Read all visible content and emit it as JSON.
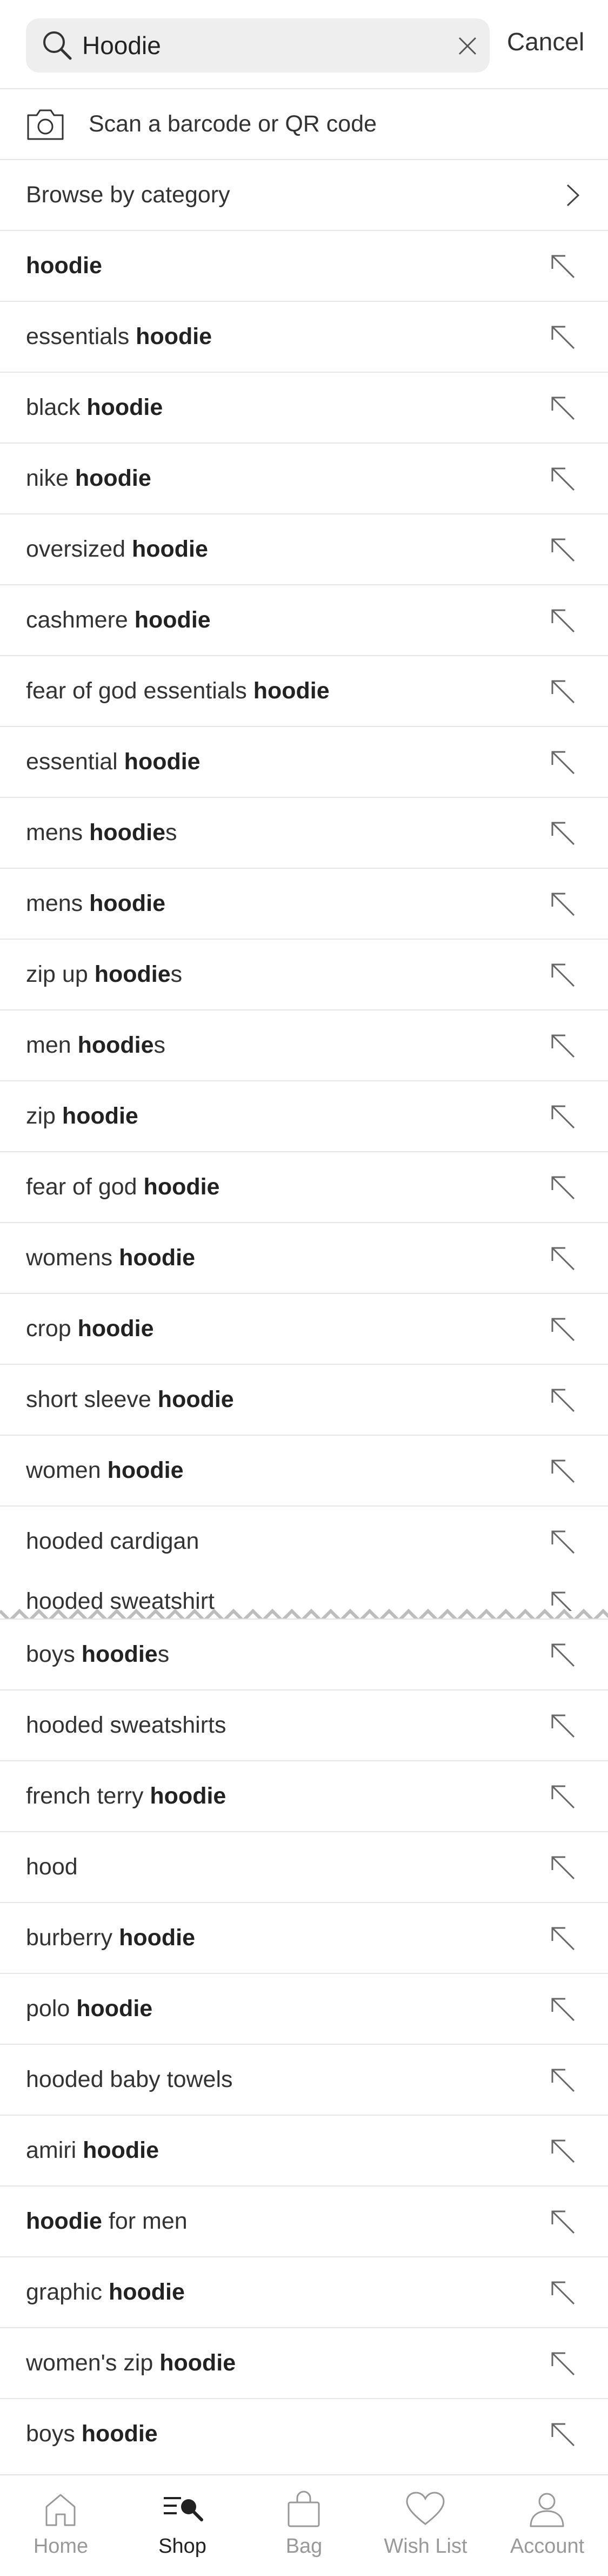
{
  "search": {
    "value": "Hoodie",
    "cancel_label": "Cancel"
  },
  "scan": {
    "label": "Scan a barcode or QR code",
    "icon": "camera-icon"
  },
  "browse": {
    "label": "Browse by category",
    "icon": "chevron-right-icon"
  },
  "suggestions": [
    {
      "before": "",
      "bold": "hoodie",
      "after": ""
    },
    {
      "before": "essentials ",
      "bold": "hoodie",
      "after": ""
    },
    {
      "before": "black ",
      "bold": "hoodie",
      "after": ""
    },
    {
      "before": "nike ",
      "bold": "hoodie",
      "after": ""
    },
    {
      "before": "oversized ",
      "bold": "hoodie",
      "after": ""
    },
    {
      "before": "cashmere ",
      "bold": "hoodie",
      "after": ""
    },
    {
      "before": "fear of god essentials ",
      "bold": "hoodie",
      "after": ""
    },
    {
      "before": "essential ",
      "bold": "hoodie",
      "after": ""
    },
    {
      "before": "mens ",
      "bold": "hoodie",
      "after": "s"
    },
    {
      "before": "mens ",
      "bold": "hoodie",
      "after": ""
    },
    {
      "before": "zip up ",
      "bold": "hoodie",
      "after": "s"
    },
    {
      "before": "men ",
      "bold": "hoodie",
      "after": "s"
    },
    {
      "before": "zip ",
      "bold": "hoodie",
      "after": ""
    },
    {
      "before": "fear of god ",
      "bold": "hoodie",
      "after": ""
    },
    {
      "before": "womens ",
      "bold": "hoodie",
      "after": ""
    },
    {
      "before": "crop ",
      "bold": "hoodie",
      "after": ""
    },
    {
      "before": "short sleeve ",
      "bold": "hoodie",
      "after": ""
    },
    {
      "before": "women ",
      "bold": "hoodie",
      "after": ""
    },
    {
      "before": "hooded cardigan",
      "bold": "",
      "after": ""
    }
  ],
  "torn_suggestion": {
    "before": "hooded sweatshirt",
    "bold": "",
    "after": ""
  },
  "suggestions_lower": [
    {
      "before": "boys ",
      "bold": "hoodie",
      "after": "s"
    },
    {
      "before": "hooded sweatshirts",
      "bold": "",
      "after": ""
    },
    {
      "before": "french terry ",
      "bold": "hoodie",
      "after": ""
    },
    {
      "before": "hood",
      "bold": "",
      "after": ""
    },
    {
      "before": "burberry ",
      "bold": "hoodie",
      "after": ""
    },
    {
      "before": "polo ",
      "bold": "hoodie",
      "after": ""
    },
    {
      "before": "hooded baby towels",
      "bold": "",
      "after": ""
    },
    {
      "before": "amiri ",
      "bold": "hoodie",
      "after": ""
    },
    {
      "before": "",
      "bold": "hoodie",
      "after": " for men"
    },
    {
      "before": "graphic ",
      "bold": "hoodie",
      "after": ""
    },
    {
      "before": "women's zip ",
      "bold": "hoodie",
      "after": ""
    },
    {
      "before": "boys ",
      "bold": "hoodie",
      "after": ""
    }
  ],
  "tabs": [
    {
      "label": "Home",
      "icon": "home-icon",
      "active": false
    },
    {
      "label": "Shop",
      "icon": "shop-icon",
      "active": true
    },
    {
      "label": "Bag",
      "icon": "bag-icon",
      "active": false
    },
    {
      "label": "Wish List",
      "icon": "heart-icon",
      "active": false
    },
    {
      "label": "Account",
      "icon": "account-icon",
      "active": false
    }
  ],
  "colors": {
    "text": "#333333",
    "muted": "#999999",
    "divider": "#e6e6e6",
    "field": "#eeeeee"
  }
}
